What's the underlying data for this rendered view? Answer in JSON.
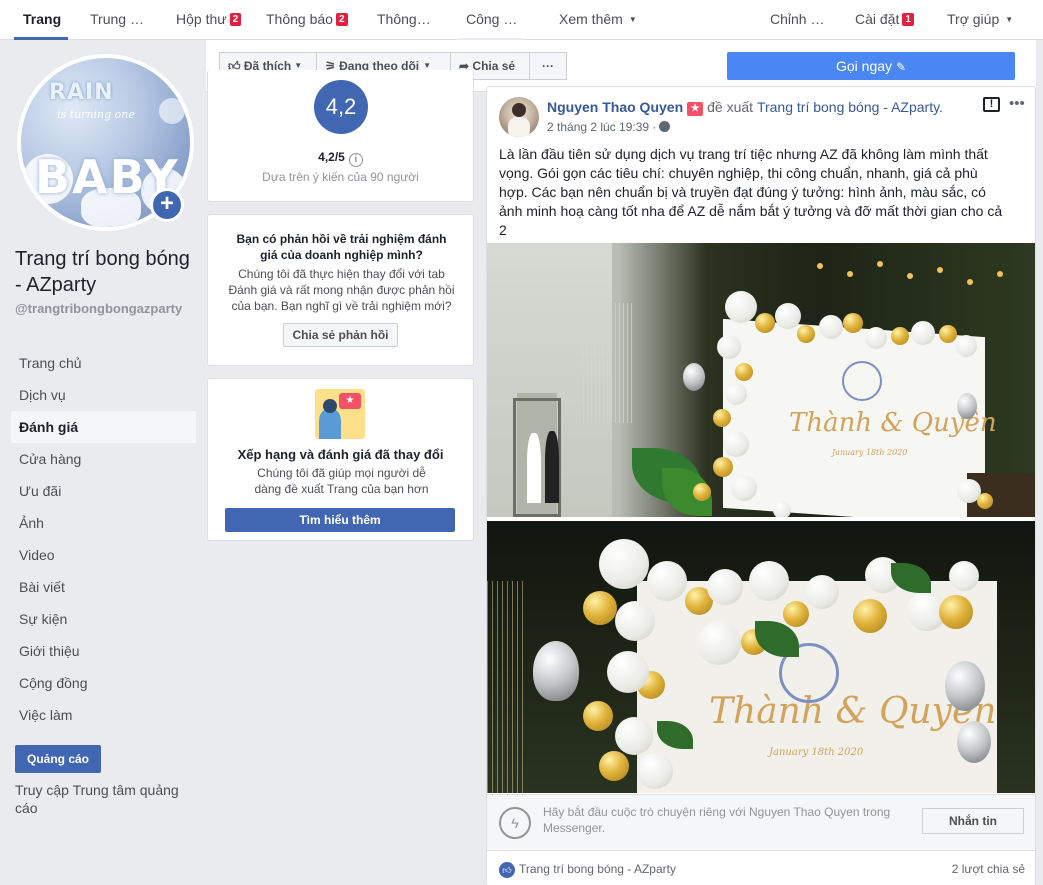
{
  "topnav": {
    "tabs": [
      {
        "label": "Trang",
        "badge": ""
      },
      {
        "label": "Trung …",
        "badge": ""
      },
      {
        "label": "Hộp thư",
        "badge": "2"
      },
      {
        "label": "Thông báo",
        "badge": "2"
      },
      {
        "label": "Thông…",
        "badge": ""
      },
      {
        "label": "Công …",
        "badge": ""
      },
      {
        "label": "Xem thêm",
        "badge": ""
      }
    ],
    "right": [
      {
        "label": "Chỉnh …",
        "badge": ""
      },
      {
        "label": "Cài đặt",
        "badge": "1"
      },
      {
        "label": "Trợ giúp",
        "badge": ""
      }
    ]
  },
  "page": {
    "avatar_text": {
      "line1": "RAIN",
      "line2": "is turning one",
      "line3": "BABY"
    },
    "name": "Trang trí bong bóng - AZparty",
    "handle": "@trangtribongbongazparty"
  },
  "sidebar": {
    "items": [
      {
        "label": "Trang chủ"
      },
      {
        "label": "Dịch vụ"
      },
      {
        "label": "Đánh giá"
      },
      {
        "label": "Cửa hàng"
      },
      {
        "label": "Ưu đãi"
      },
      {
        "label": "Ảnh"
      },
      {
        "label": "Video"
      },
      {
        "label": "Bài viết"
      },
      {
        "label": "Sự kiện"
      },
      {
        "label": "Giới thiệu"
      },
      {
        "label": "Cộng đồng"
      },
      {
        "label": "Việc làm"
      }
    ],
    "active": "Đánh giá",
    "ads_button": "Quảng cáo",
    "ads_center_link": "Truy cập Trung tâm quảng cáo"
  },
  "actionbar": {
    "liked": "Đã thích",
    "following": "Đang theo dõi",
    "share": "Chia sẻ",
    "more": "···",
    "call": "Gọi ngay"
  },
  "rating": {
    "score": "4,2",
    "score_text": "4,2/5",
    "based_on": "Dựa trên ý kiến của 90 người"
  },
  "feedback_card": {
    "title": "Bạn có phản hồi về trải nghiệm đánh giá của doanh nghiệp mình?",
    "body": "Chúng tôi đã thực hiện thay đổi với tab Đánh giá và rất mong nhận được phản hồi của bạn. Bạn nghĩ gì về trải nghiệm mới?",
    "button": "Chia sẻ phản hồi"
  },
  "change_card": {
    "title": "Xếp hạng và đánh giá đã thay đổi",
    "body": "Chúng tôi đã giúp mọi người dễ dàng đề xuất Trang của bạn hơn",
    "button": "Tìm hiểu thêm"
  },
  "post": {
    "author": "Nguyen Thao Quyen",
    "recommends": "đề xuất",
    "page_link": "Trang trí bong bóng - AZparty.",
    "date": "2 tháng 2 lúc 19:39 ·",
    "text": "Là lần đầu tiên sử dụng dịch vụ trang trí tiệc nhưng AZ đã không làm mình thất vọng. Gói gọn các tiêu chí: chuyên nghiệp, thi công chuẩn, nhanh, giá cả phù hợp. Các bạn nên chuẩn bị và truyền đạt đúng ý tưởng: hình ảnh, màu sắc, có ảnh minh hoạ càng tốt nha để AZ dễ nắm bắt ý tưởng và đỡ mất thời gian cho cả 2",
    "photo1_script": {
      "names": "Thành & Quyên",
      "date": "January 18th 2020"
    },
    "photo2_script": {
      "names": "Thành & Quyên",
      "date": "January 18th 2020"
    },
    "messenger_prompt": "Hãy bắt đầu cuộc trò chuyện riêng với Nguyen Thao Quyen trong Messenger.",
    "message_button": "Nhắn tin",
    "footer_page": "Trang trí bong bóng - AZparty",
    "shares": "2 lượt chia sẻ"
  },
  "colors": {
    "brand": "#4267b2",
    "link": "#365899",
    "badge": "#e41e3f",
    "background": "#e9ebee"
  }
}
